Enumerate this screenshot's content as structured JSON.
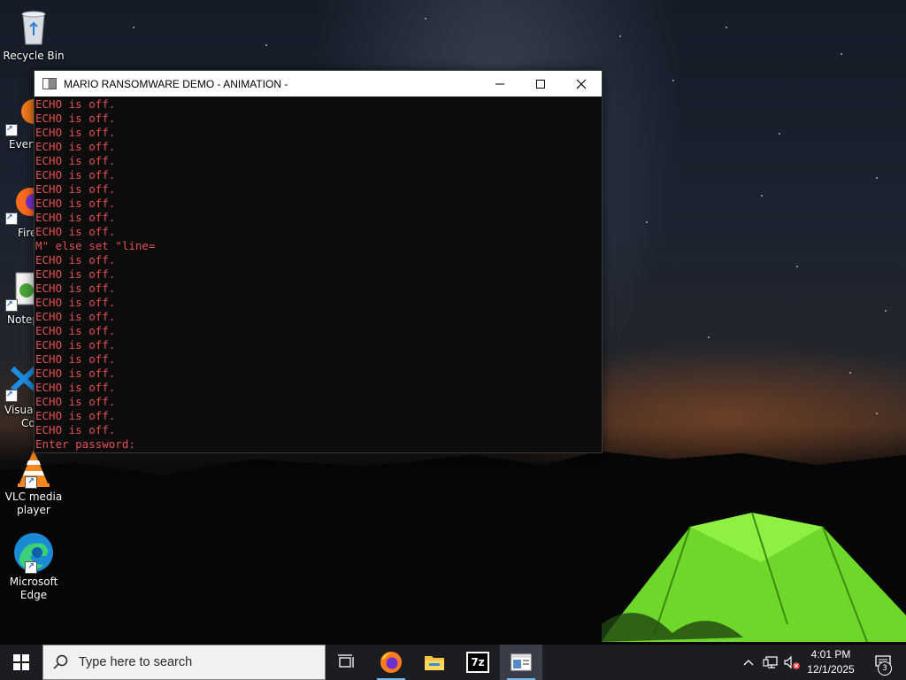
{
  "desktop": {
    "icons": [
      {
        "label": "Recycle Bin",
        "icon": "recycle-bin-icon"
      },
      {
        "label": "Every",
        "icon": "everything-icon"
      },
      {
        "label": "Fire",
        "icon": "firefox-icon"
      },
      {
        "label": "Notep",
        "icon": "notepad-icon"
      },
      {
        "label": "Visual",
        "label2": "Co",
        "icon": "vscode-icon"
      },
      {
        "label": "VLC media",
        "label2": "player",
        "icon": "vlc-icon"
      },
      {
        "label": "Microsoft",
        "label2": "Edge",
        "icon": "edge-icon"
      }
    ]
  },
  "console": {
    "title": "MARIO RANSOMWARE DEMO - ANIMATION -",
    "lines": [
      "ECHO is off.",
      "ECHO is off.",
      "ECHO is off.",
      "ECHO is off.",
      "ECHO is off.",
      "ECHO is off.",
      "ECHO is off.",
      "ECHO is off.",
      "ECHO is off.",
      "ECHO is off.",
      "M\" else set \"line=",
      "ECHO is off.",
      "ECHO is off.",
      "ECHO is off.",
      "ECHO is off.",
      "ECHO is off.",
      "ECHO is off.",
      "ECHO is off.",
      "ECHO is off.",
      "ECHO is off.",
      "ECHO is off.",
      "ECHO is off.",
      "ECHO is off.",
      "ECHO is off.",
      "Enter password:"
    ],
    "text_color": "#e25252",
    "bg_color": "#0c0c0c"
  },
  "taskbar": {
    "search_placeholder": "Type here to search",
    "apps": [
      "task-view-icon",
      "firefox-icon",
      "file-explorer-icon",
      "7zip-icon",
      "console-icon"
    ],
    "sevenzip_label": "7z",
    "clock_time": "4:01 PM",
    "clock_date": "12/1/2025",
    "notification_count": "3"
  }
}
